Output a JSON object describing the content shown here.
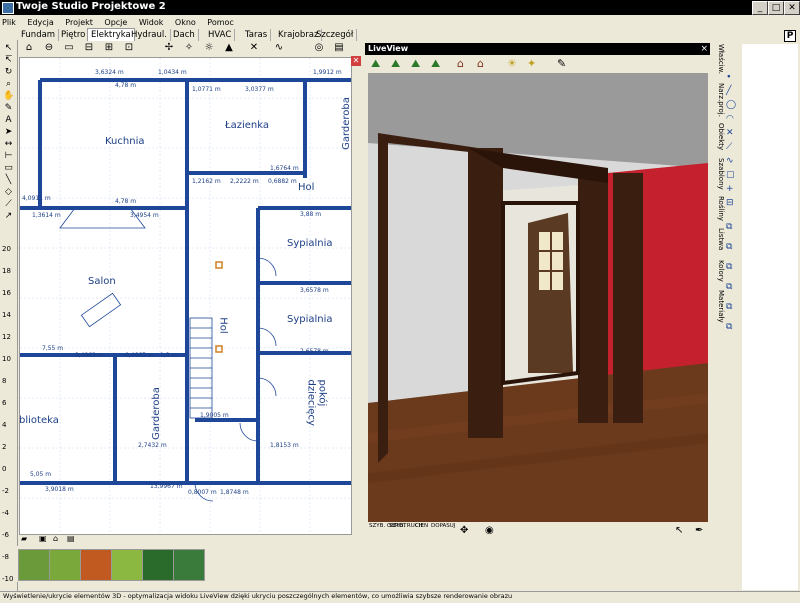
{
  "window": {
    "title": "Twoje Studio Projektowe 2",
    "min_label": "_",
    "max_label": "□",
    "close_label": "✕"
  },
  "menu": [
    "Plik",
    "Edycja",
    "Projekt",
    "Opcje",
    "Widok",
    "Okno",
    "Pomoc"
  ],
  "tabs": [
    "Fundam",
    "Piętro",
    "Elektryka",
    "Hydraul.",
    "Dach",
    "HVAC",
    "Taras",
    "Krajobraz",
    "Szczegół"
  ],
  "active_tab": "Elektryka",
  "ruler_left": [
    "20",
    "18",
    "16",
    "14",
    "12",
    "10",
    "8",
    "6",
    "4",
    "2",
    "0",
    "-2",
    "-4",
    "-6",
    "-8",
    "-10",
    "-12"
  ],
  "plan": {
    "rooms": [
      "Kuchnia",
      "Łazienka",
      "Garderoba",
      "Hol",
      "Sypialnia",
      "Salon",
      "Sypialnia",
      "Hol",
      "Garderoba",
      "pokój dziecięcy",
      "blioteka"
    ],
    "dims": [
      "3,6324 m",
      "1,0434 m",
      "1,9912 m",
      "1,0771 m",
      "3,0377 m",
      "4,78 m",
      "4,78 m",
      "3,4954 m",
      "1,6764 m",
      "1,2162 m",
      "2,2222 m",
      "0,6882 m",
      "3,88 m",
      "3,6578 m",
      "2,6578 m",
      "4,0911 m",
      "1,3614 m",
      "7,55 m",
      "3,4962 m",
      "0,4665 m",
      "1,3 m",
      "1,9005 m",
      "2,7432 m",
      "1,8153 m",
      "5,05 m",
      "3,9018 m",
      "13,9967 m",
      "0,8007 m",
      "1,8748 m"
    ]
  },
  "liveview": {
    "title": "LiveView",
    "close": "×",
    "bottom_labels": [
      "SZYB. OBROT",
      "SZYB. RUCH",
      "CIEN",
      "DOPASUJ"
    ]
  },
  "right_panel": {
    "tabs": [
      "Właściw.",
      "Narz.proj.",
      "Obiekty",
      "Szablony",
      "Rośliny",
      "Listwa",
      "Kolory",
      "Materiały"
    ]
  },
  "status": "Wyświetlenie/ukrycie elementów 3D - optymalizacja widoku LiveView dzięki ukryciu poszczególnych elementów, co umożliwia szybsze renderowanie obrazu",
  "colors": {
    "wall_blue": "#1E4799",
    "red_wall": "#C4202E",
    "floor": "#6B3A1C",
    "door_dark": "#3A1E10"
  }
}
